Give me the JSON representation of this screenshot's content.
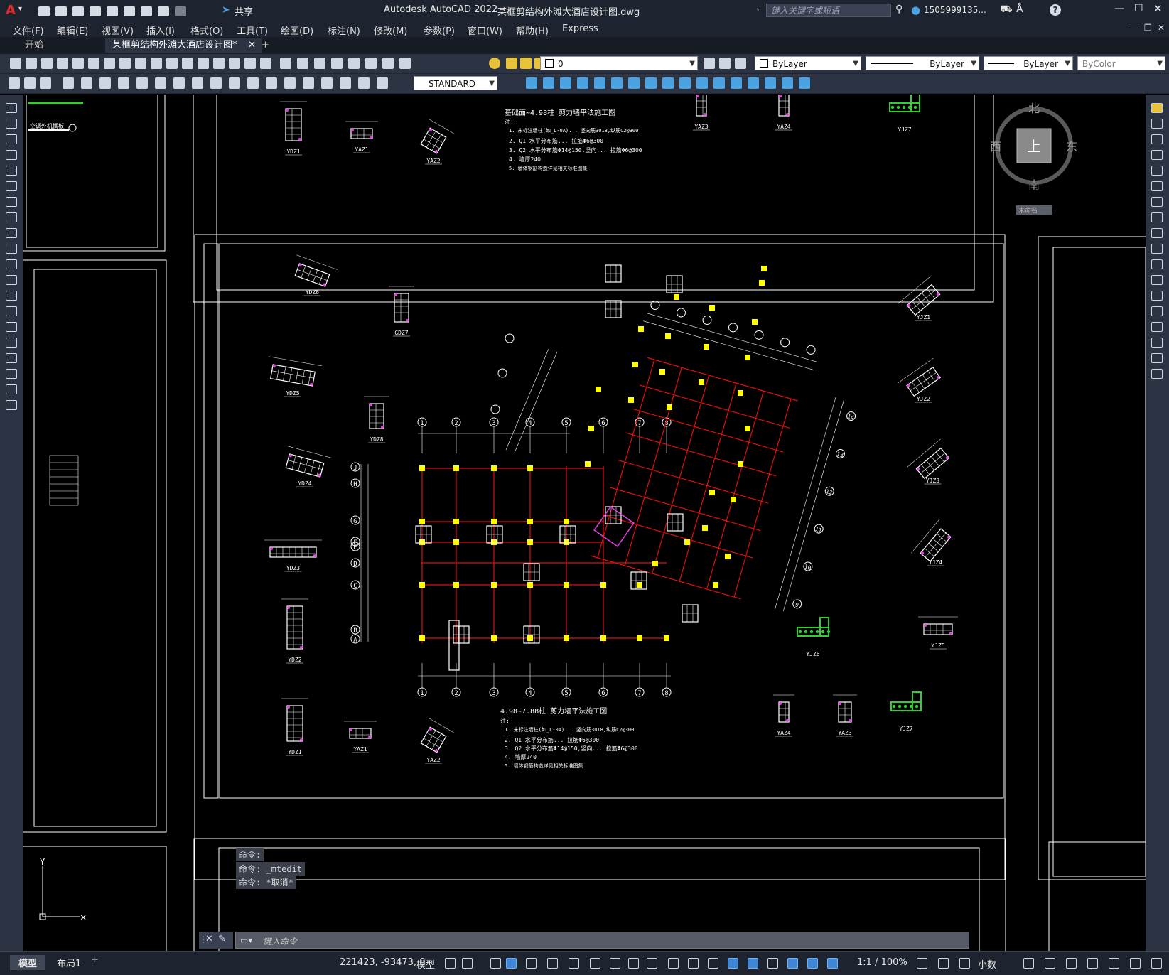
{
  "app": {
    "title": "Autodesk AutoCAD 2022",
    "filename": "某框剪结构外滩大酒店设计图.dwg",
    "search_placeholder": "键入关键字或短语",
    "user": "1505999135...",
    "share_label": "共享"
  },
  "menu": [
    "文件(F)",
    "编辑(E)",
    "视图(V)",
    "插入(I)",
    "格式(O)",
    "工具(T)",
    "绘图(D)",
    "标注(N)",
    "修改(M)",
    "参数(P)",
    "窗口(W)",
    "帮助(H)",
    "Express"
  ],
  "tabs": {
    "start": "开始",
    "document": "某框剪结构外滩大酒店设计图*",
    "close": "✕",
    "add": "+"
  },
  "layer": {
    "name": "0",
    "color": "ByLayer",
    "linetype": "ByLayer",
    "lineweight": "ByLayer",
    "plotstyle": "ByColor"
  },
  "textstyle": "STANDARD",
  "viewcube": {
    "north": "北",
    "south": "南",
    "east": "东",
    "west": "西",
    "top": "上",
    "wcs": "未命名"
  },
  "drawing": {
    "plan_title_top": "基础面~4.98柱 剪力墙平法施工图",
    "plan_title_bottom": "4.98~7.88柱 剪力墙平法施工图",
    "note_header": "注:",
    "notes_top": [
      "1. 未标注墙柱(如_L-0A)... 竖向筋3018,纵筋C2@300",
      "2. Q1 水平分布筋... 拉筋Φ6@300",
      "3. Q2 水平分布筋Φ14@150,竖向... 拉筋Φ6@300",
      "4. 墙厚240",
      "5. 墙体钢筋构造详见相关标准图集"
    ],
    "notes_bottom": [
      "1. 未标注墙柱(如_L-0A)... 竖向筋3018,纵筋C2@300",
      "2. Q1 水平分布筋... 拉筋Φ6@300",
      "3. Q2 水平分布筋Φ14@150,竖向... 拉筋Φ6@300",
      "4. 墙厚240",
      "5. 墙体钢筋构造详见相关标准图集"
    ],
    "columns_left": [
      "YDZ6",
      "GDZ7",
      "YDZ5",
      "YDZ8",
      "YDZ4",
      "YDZ3",
      "YDZ2",
      "YDZ1"
    ],
    "columns_right": [
      "YJZ1",
      "YJZ2",
      "YJZ3",
      "YJZ4",
      "YJZ6",
      "YJZ5",
      "YJZ7",
      "YAZ3",
      "YAZ4"
    ],
    "columns_top": [
      "YDZ1",
      "YAZ1",
      "YAZ2",
      "YAZ3",
      "YAZ4",
      "YJZ7"
    ],
    "columns_bottom": [
      "YDZ1",
      "YAZ1",
      "YAZ2",
      "YAZ3",
      "YAZ4",
      "YJZ7"
    ],
    "grid_x": [
      "1",
      "2",
      "3",
      "4",
      "5",
      "6",
      "7",
      "8"
    ],
    "grid_y": [
      "J",
      "H",
      "G",
      "F",
      "E",
      "D",
      "C",
      "B",
      "A"
    ],
    "grid_rotated": [
      "14",
      "13",
      "12",
      "11",
      "10",
      "9"
    ],
    "legend_text": "空调外机搁板"
  },
  "command": {
    "lines": [
      "命令:",
      "命令: _mtedit",
      "命令: *取消*"
    ],
    "placeholder": "键入命令"
  },
  "status": {
    "model_tab": "模型",
    "layout_tab": "布局1",
    "add": "+",
    "coords": "221423, -93473, 0",
    "mode": "模型",
    "scale": "1:1 / 100%",
    "units": "小数"
  },
  "colors": {
    "chrome": "#2c3342",
    "title": "#1e2330",
    "grid_red": "#e01010",
    "column_yellow": "#ffff00",
    "rebar_green": "#30d030",
    "magenta": "#e040e0"
  }
}
